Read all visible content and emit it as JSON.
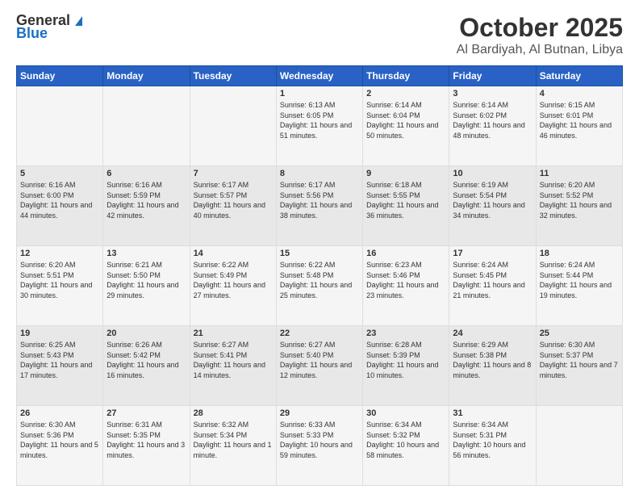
{
  "logo": {
    "general": "General",
    "blue": "Blue"
  },
  "header": {
    "title": "October 2025",
    "subtitle": "Al Bardiyah, Al Butnan, Libya"
  },
  "weekdays": [
    "Sunday",
    "Monday",
    "Tuesday",
    "Wednesday",
    "Thursday",
    "Friday",
    "Saturday"
  ],
  "weeks": [
    [
      {
        "day": "",
        "sunrise": "",
        "sunset": "",
        "daylight": ""
      },
      {
        "day": "",
        "sunrise": "",
        "sunset": "",
        "daylight": ""
      },
      {
        "day": "",
        "sunrise": "",
        "sunset": "",
        "daylight": ""
      },
      {
        "day": "1",
        "sunrise": "Sunrise: 6:13 AM",
        "sunset": "Sunset: 6:05 PM",
        "daylight": "Daylight: 11 hours and 51 minutes."
      },
      {
        "day": "2",
        "sunrise": "Sunrise: 6:14 AM",
        "sunset": "Sunset: 6:04 PM",
        "daylight": "Daylight: 11 hours and 50 minutes."
      },
      {
        "day": "3",
        "sunrise": "Sunrise: 6:14 AM",
        "sunset": "Sunset: 6:02 PM",
        "daylight": "Daylight: 11 hours and 48 minutes."
      },
      {
        "day": "4",
        "sunrise": "Sunrise: 6:15 AM",
        "sunset": "Sunset: 6:01 PM",
        "daylight": "Daylight: 11 hours and 46 minutes."
      }
    ],
    [
      {
        "day": "5",
        "sunrise": "Sunrise: 6:16 AM",
        "sunset": "Sunset: 6:00 PM",
        "daylight": "Daylight: 11 hours and 44 minutes."
      },
      {
        "day": "6",
        "sunrise": "Sunrise: 6:16 AM",
        "sunset": "Sunset: 5:59 PM",
        "daylight": "Daylight: 11 hours and 42 minutes."
      },
      {
        "day": "7",
        "sunrise": "Sunrise: 6:17 AM",
        "sunset": "Sunset: 5:57 PM",
        "daylight": "Daylight: 11 hours and 40 minutes."
      },
      {
        "day": "8",
        "sunrise": "Sunrise: 6:17 AM",
        "sunset": "Sunset: 5:56 PM",
        "daylight": "Daylight: 11 hours and 38 minutes."
      },
      {
        "day": "9",
        "sunrise": "Sunrise: 6:18 AM",
        "sunset": "Sunset: 5:55 PM",
        "daylight": "Daylight: 11 hours and 36 minutes."
      },
      {
        "day": "10",
        "sunrise": "Sunrise: 6:19 AM",
        "sunset": "Sunset: 5:54 PM",
        "daylight": "Daylight: 11 hours and 34 minutes."
      },
      {
        "day": "11",
        "sunrise": "Sunrise: 6:20 AM",
        "sunset": "Sunset: 5:52 PM",
        "daylight": "Daylight: 11 hours and 32 minutes."
      }
    ],
    [
      {
        "day": "12",
        "sunrise": "Sunrise: 6:20 AM",
        "sunset": "Sunset: 5:51 PM",
        "daylight": "Daylight: 11 hours and 30 minutes."
      },
      {
        "day": "13",
        "sunrise": "Sunrise: 6:21 AM",
        "sunset": "Sunset: 5:50 PM",
        "daylight": "Daylight: 11 hours and 29 minutes."
      },
      {
        "day": "14",
        "sunrise": "Sunrise: 6:22 AM",
        "sunset": "Sunset: 5:49 PM",
        "daylight": "Daylight: 11 hours and 27 minutes."
      },
      {
        "day": "15",
        "sunrise": "Sunrise: 6:22 AM",
        "sunset": "Sunset: 5:48 PM",
        "daylight": "Daylight: 11 hours and 25 minutes."
      },
      {
        "day": "16",
        "sunrise": "Sunrise: 6:23 AM",
        "sunset": "Sunset: 5:46 PM",
        "daylight": "Daylight: 11 hours and 23 minutes."
      },
      {
        "day": "17",
        "sunrise": "Sunrise: 6:24 AM",
        "sunset": "Sunset: 5:45 PM",
        "daylight": "Daylight: 11 hours and 21 minutes."
      },
      {
        "day": "18",
        "sunrise": "Sunrise: 6:24 AM",
        "sunset": "Sunset: 5:44 PM",
        "daylight": "Daylight: 11 hours and 19 minutes."
      }
    ],
    [
      {
        "day": "19",
        "sunrise": "Sunrise: 6:25 AM",
        "sunset": "Sunset: 5:43 PM",
        "daylight": "Daylight: 11 hours and 17 minutes."
      },
      {
        "day": "20",
        "sunrise": "Sunrise: 6:26 AM",
        "sunset": "Sunset: 5:42 PM",
        "daylight": "Daylight: 11 hours and 16 minutes."
      },
      {
        "day": "21",
        "sunrise": "Sunrise: 6:27 AM",
        "sunset": "Sunset: 5:41 PM",
        "daylight": "Daylight: 11 hours and 14 minutes."
      },
      {
        "day": "22",
        "sunrise": "Sunrise: 6:27 AM",
        "sunset": "Sunset: 5:40 PM",
        "daylight": "Daylight: 11 hours and 12 minutes."
      },
      {
        "day": "23",
        "sunrise": "Sunrise: 6:28 AM",
        "sunset": "Sunset: 5:39 PM",
        "daylight": "Daylight: 11 hours and 10 minutes."
      },
      {
        "day": "24",
        "sunrise": "Sunrise: 6:29 AM",
        "sunset": "Sunset: 5:38 PM",
        "daylight": "Daylight: 11 hours and 8 minutes."
      },
      {
        "day": "25",
        "sunrise": "Sunrise: 6:30 AM",
        "sunset": "Sunset: 5:37 PM",
        "daylight": "Daylight: 11 hours and 7 minutes."
      }
    ],
    [
      {
        "day": "26",
        "sunrise": "Sunrise: 6:30 AM",
        "sunset": "Sunset: 5:36 PM",
        "daylight": "Daylight: 11 hours and 5 minutes."
      },
      {
        "day": "27",
        "sunrise": "Sunrise: 6:31 AM",
        "sunset": "Sunset: 5:35 PM",
        "daylight": "Daylight: 11 hours and 3 minutes."
      },
      {
        "day": "28",
        "sunrise": "Sunrise: 6:32 AM",
        "sunset": "Sunset: 5:34 PM",
        "daylight": "Daylight: 11 hours and 1 minute."
      },
      {
        "day": "29",
        "sunrise": "Sunrise: 6:33 AM",
        "sunset": "Sunset: 5:33 PM",
        "daylight": "Daylight: 10 hours and 59 minutes."
      },
      {
        "day": "30",
        "sunrise": "Sunrise: 6:34 AM",
        "sunset": "Sunset: 5:32 PM",
        "daylight": "Daylight: 10 hours and 58 minutes."
      },
      {
        "day": "31",
        "sunrise": "Sunrise: 6:34 AM",
        "sunset": "Sunset: 5:31 PM",
        "daylight": "Daylight: 10 hours and 56 minutes."
      },
      {
        "day": "",
        "sunrise": "",
        "sunset": "",
        "daylight": ""
      }
    ]
  ]
}
